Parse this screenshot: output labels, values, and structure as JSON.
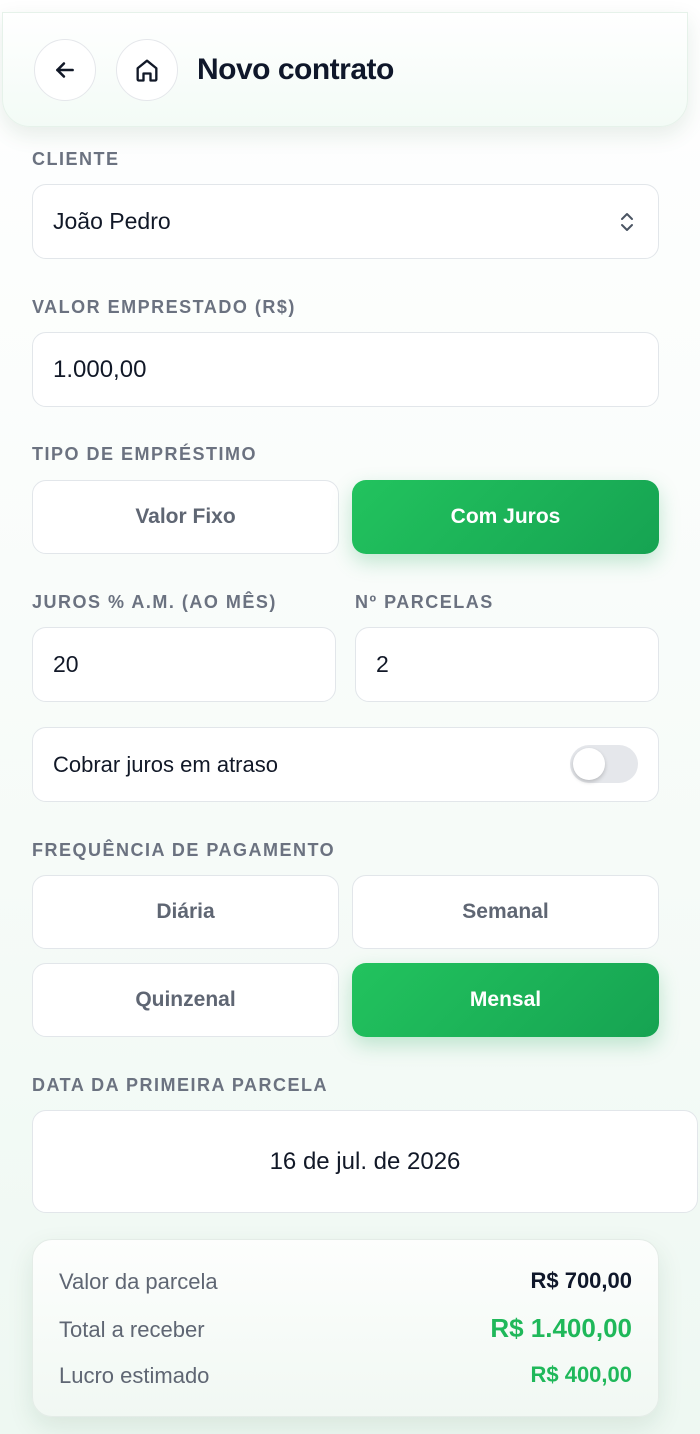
{
  "header": {
    "title": "Novo contrato"
  },
  "cliente": {
    "label": "CLIENTE",
    "value": "João Pedro"
  },
  "valor": {
    "label": "VALOR EMPRESTADO (R$)",
    "value": "1.000,00"
  },
  "tipo": {
    "label": "TIPO DE EMPRÉSTIMO",
    "options": [
      "Valor Fixo",
      "Com Juros"
    ],
    "selected": "Com Juros"
  },
  "juros": {
    "label": "JUROS % A.M. (AO MÊS)",
    "value": "20"
  },
  "parcelas": {
    "label": "Nº PARCELAS",
    "value": "2"
  },
  "atraso": {
    "label": "Cobrar juros em atraso",
    "enabled": false
  },
  "frequencia": {
    "label": "FREQUÊNCIA DE PAGAMENTO",
    "options": [
      "Diária",
      "Semanal",
      "Quinzenal",
      "Mensal"
    ],
    "selected": "Mensal"
  },
  "data": {
    "label": "DATA DA PRIMEIRA PARCELA",
    "value": "16 de jul. de 2026"
  },
  "summary": {
    "parcela_label": "Valor da parcela",
    "parcela_value": "R$ 700,00",
    "total_label": "Total a receber",
    "total_value": "R$ 1.400,00",
    "lucro_label": "Lucro estimado",
    "lucro_value": "R$ 400,00"
  },
  "colors": {
    "accent": "#1fb85a",
    "text": "#111827",
    "muted": "#6b7280"
  },
  "icons": {
    "back": "arrow-left-icon",
    "home": "home-icon",
    "select": "chevron-up-down-icon"
  }
}
